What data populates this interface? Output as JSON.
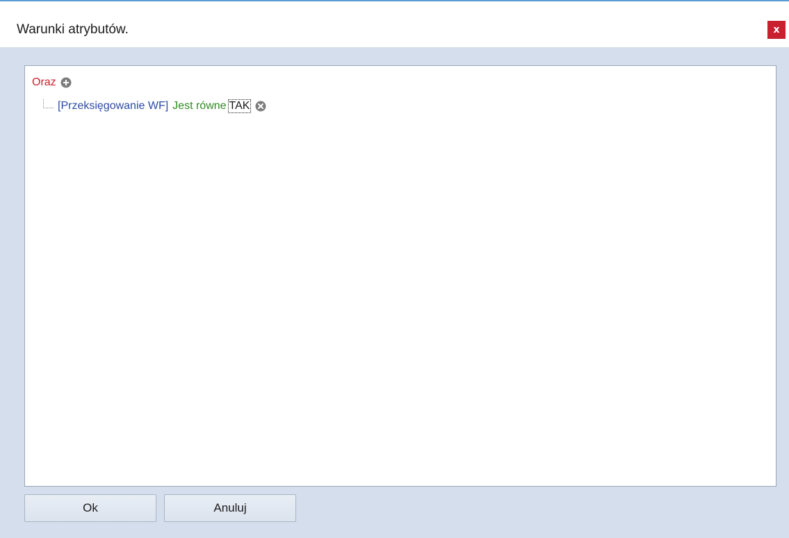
{
  "window": {
    "title": "Warunki atrybutów.",
    "close_label": "x"
  },
  "tree": {
    "root": {
      "operator": "Oraz",
      "add_icon": "plus-circle-icon"
    },
    "conditions": [
      {
        "field": "[Przeksięgowanie WF]",
        "operator": "Jest równe",
        "value": "TAK",
        "remove_icon": "x-circle-icon"
      }
    ]
  },
  "buttons": {
    "ok_label": "Ok",
    "cancel_label": "Anuluj"
  },
  "colors": {
    "group_operator": "#c8202f",
    "field": "#2c4ba3",
    "condition_operator": "#2f8a1f",
    "close_button": "#c8202f"
  }
}
